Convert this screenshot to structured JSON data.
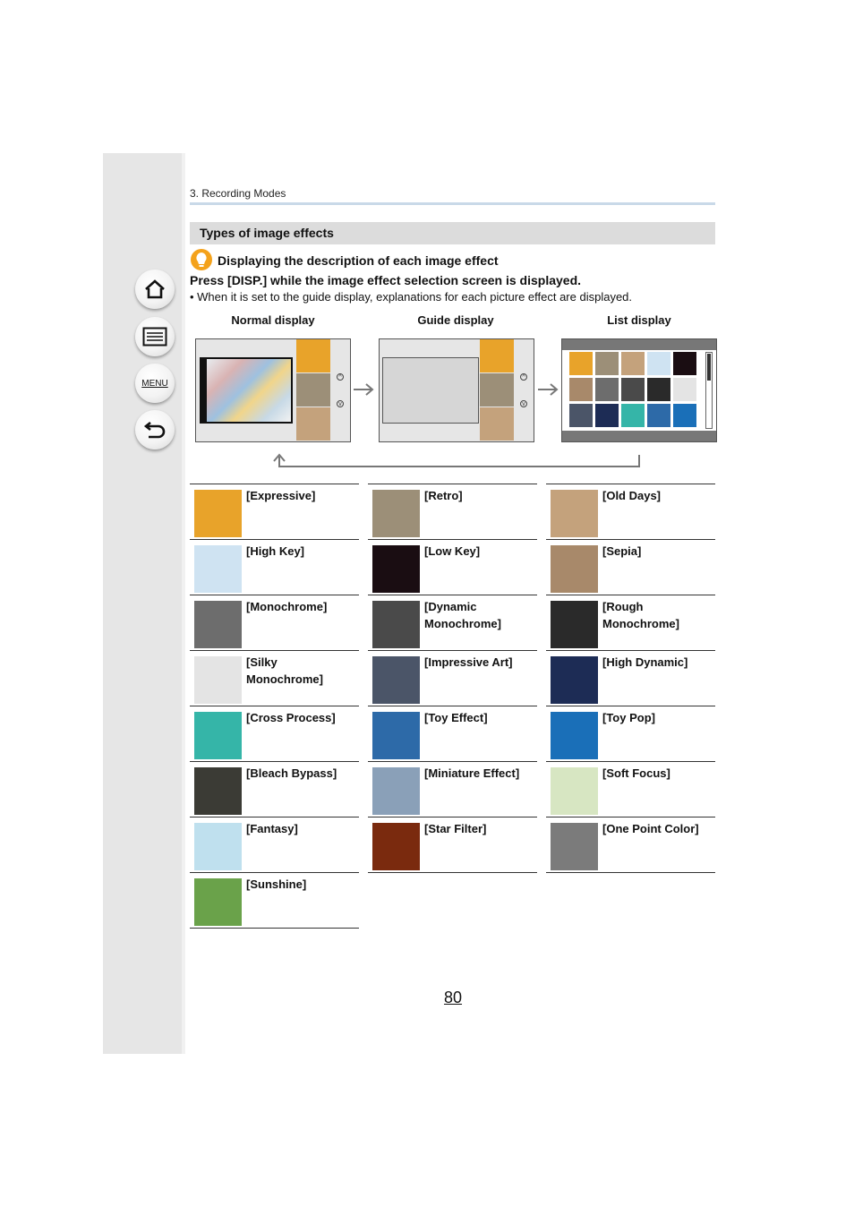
{
  "breadcrumb": "3. Recording Modes",
  "section_title": "Types of image effects",
  "tip_title": "Displaying the description of each image effect",
  "instruction": "Press [DISP.] while the image effect selection screen is displayed.",
  "note": "• When it is set to the guide display, explanations for each picture effect are displayed.",
  "displays": {
    "normal": "Normal display",
    "guide": "Guide display",
    "list": "List display"
  },
  "nav": {
    "home_icon": "home-icon",
    "toc_icon": "toc-list-icon",
    "menu_label": "MENU",
    "back_icon": "back-arrow-icon"
  },
  "effects": {
    "col1": [
      {
        "label": "[Expressive]",
        "color": "#e8a32a"
      },
      {
        "label": "[High Key]",
        "color": "#cfe3f2"
      },
      {
        "label": "[Monochrome]",
        "color": "#6d6d6d"
      },
      {
        "label": "[Silky Monochrome]",
        "color": "#e4e4e4"
      },
      {
        "label": "[Cross Process]",
        "color": "#35b5a8"
      },
      {
        "label": "[Bleach Bypass]",
        "color": "#3b3b35"
      },
      {
        "label": "[Fantasy]",
        "color": "#bfe0ee"
      },
      {
        "label": "[Sunshine]",
        "color": "#6aa24a"
      }
    ],
    "col2": [
      {
        "label": "[Retro]",
        "color": "#9c8f78"
      },
      {
        "label": "[Low Key]",
        "color": "#1a0d12"
      },
      {
        "label": "[Dynamic Monochrome]",
        "color": "#4a4a4a"
      },
      {
        "label": "[Impressive Art]",
        "color": "#4b5568"
      },
      {
        "label": "[Toy Effect]",
        "color": "#2d6aa8"
      },
      {
        "label": "[Miniature Effect]",
        "color": "#8aa0b8"
      },
      {
        "label": "[Star Filter]",
        "color": "#7a2a0e"
      }
    ],
    "col3": [
      {
        "label": "[Old Days]",
        "color": "#c4a27c"
      },
      {
        "label": "[Sepia]",
        "color": "#a8896a"
      },
      {
        "label": "[Rough Monochrome]",
        "color": "#2a2a2a"
      },
      {
        "label": "[High Dynamic]",
        "color": "#1d2c55"
      },
      {
        "label": "[Toy Pop]",
        "color": "#1a6fb8"
      },
      {
        "label": "[Soft Focus]",
        "color": "#d7e6c2"
      },
      {
        "label": "[One Point Color]",
        "color": "#7b7b7b"
      }
    ]
  },
  "page_number": "80"
}
